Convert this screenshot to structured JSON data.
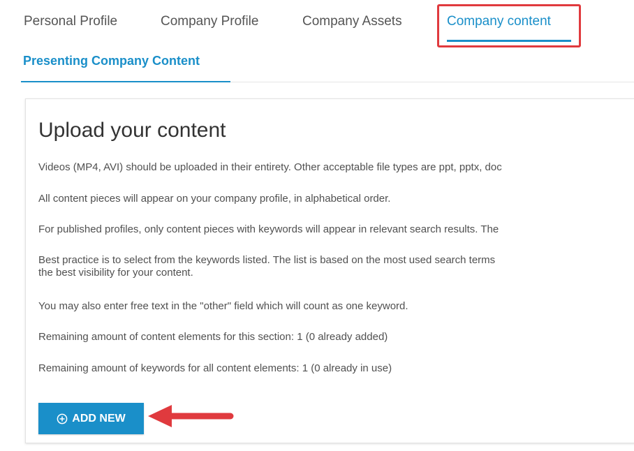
{
  "tabs": [
    {
      "label": "Personal Profile"
    },
    {
      "label": "Company Profile"
    },
    {
      "label": "Company Assets"
    },
    {
      "label": "Company content"
    }
  ],
  "active_tab": "Company content",
  "subtab": {
    "label": "Presenting Company Content"
  },
  "card": {
    "title": "Upload your content",
    "paragraphs": [
      "Videos (MP4, AVI) should be uploaded in their entirety. Other acceptable file types are ppt, pptx, doc",
      "All content pieces will appear on your company profile, in alphabetical order.",
      "For published profiles, only content pieces with keywords will appear in relevant search results. The",
      "Best practice is to select from the keywords listed. The list is based on the most used search terms",
      "the best visibility for your content.",
      "You may also enter free text in the \"other\" field which will count as one keyword.",
      "Remaining amount of content elements for this section: 1 (0 already added)",
      "Remaining amount of keywords for all content elements: 1 (0 already in use)"
    ],
    "add_button": {
      "label": "ADD NEW",
      "icon": "plus-circle-icon"
    }
  },
  "colors": {
    "accent": "#1a8fc9",
    "highlight": "#e03a3e",
    "arrow": "#e03a3e"
  }
}
